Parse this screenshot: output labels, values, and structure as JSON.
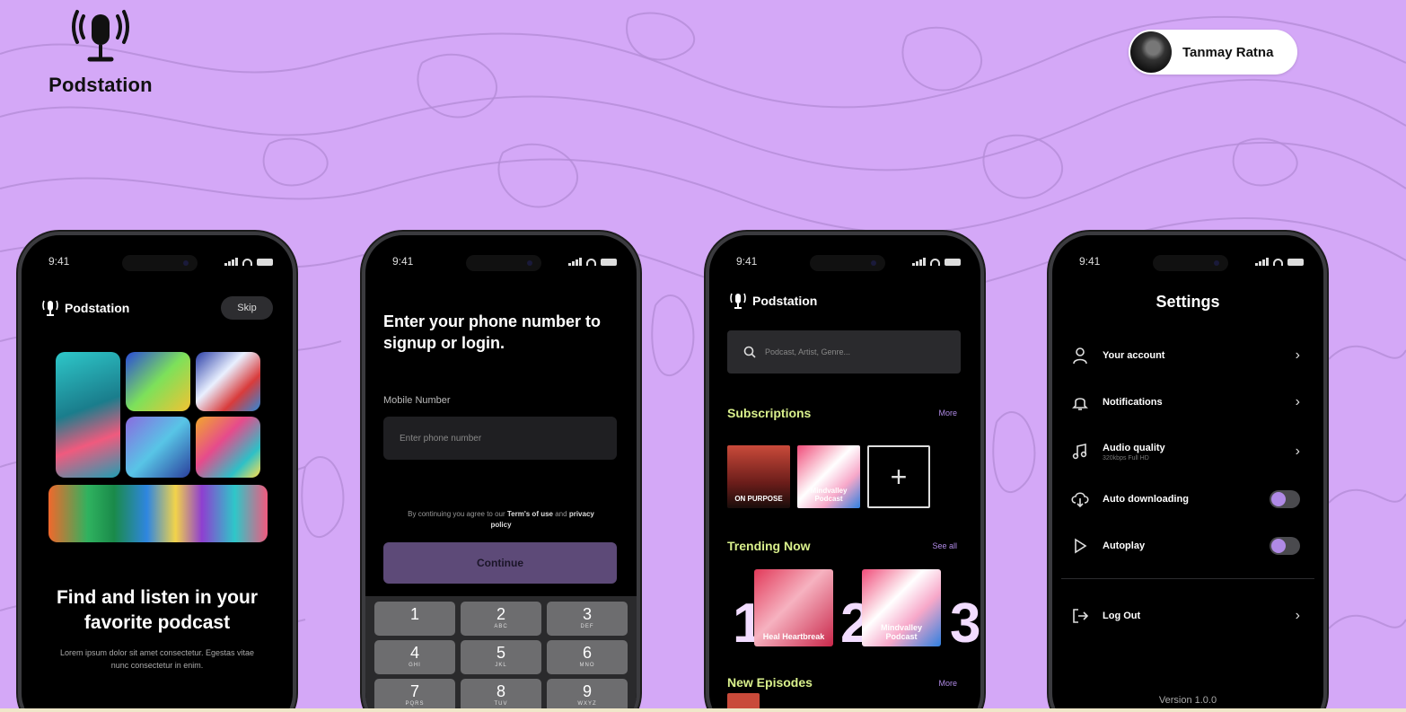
{
  "brand": {
    "name": "Podstation"
  },
  "user": {
    "name": "Tanmay Ratna"
  },
  "status_bar": {
    "time": "9:41"
  },
  "onboarding": {
    "app_name": "Podstation",
    "skip_label": "Skip",
    "title": "Find and listen in your favorite podcast",
    "subtitle": "Lorem ipsum dolor sit amet consectetur. Egestas vitae nunc consectetur in enim."
  },
  "login": {
    "title": "Enter  your phone number to signup or login.",
    "field_label": "Mobile Number",
    "phone_placeholder": "Enter phone number",
    "terms_prefix": "By continuing you agree to our",
    "terms_link": "Term's of use",
    "terms_and": "and",
    "privacy_link": "privacy policy",
    "continue_label": "Continue",
    "keypad": [
      {
        "num": "1",
        "letters": ""
      },
      {
        "num": "2",
        "letters": "ABC"
      },
      {
        "num": "3",
        "letters": "DEF"
      },
      {
        "num": "4",
        "letters": "GHI"
      },
      {
        "num": "5",
        "letters": "JKL"
      },
      {
        "num": "6",
        "letters": "MNO"
      },
      {
        "num": "7",
        "letters": "PQRS"
      },
      {
        "num": "8",
        "letters": "TUV"
      },
      {
        "num": "9",
        "letters": "WXYZ"
      }
    ]
  },
  "home": {
    "app_name": "Podstation",
    "search_placeholder": "Podcast, Artist, Genre...",
    "subscriptions": {
      "title": "Subscriptions",
      "link": "More",
      "items": [
        "ON PURPOSE",
        "Mindvalley Podcast"
      ],
      "add_label": "+"
    },
    "trending": {
      "title": "Trending Now",
      "link": "See all",
      "items": [
        {
          "rank": "1",
          "label": "Heal Heartbreak"
        },
        {
          "rank": "2",
          "label": "Mindvalley Podcast"
        },
        {
          "rank": "3",
          "label": ""
        }
      ]
    },
    "new_episodes": {
      "title": "New Episodes",
      "link": "More"
    }
  },
  "settings": {
    "title": "Settings",
    "items": [
      {
        "label": "Your account",
        "icon": "user-icon"
      },
      {
        "label": "Notifications",
        "icon": "bell-icon"
      },
      {
        "label": "Audio quality",
        "sub": "320kbps Full HD",
        "icon": "music-note-icon"
      },
      {
        "label": "Auto downloading",
        "icon": "cloud-download-icon",
        "toggle": true
      },
      {
        "label": "Autoplay",
        "icon": "play-icon",
        "toggle": true
      },
      {
        "label": "Log Out",
        "icon": "logout-icon"
      }
    ],
    "version": "Version 1.0.0"
  },
  "colors": {
    "background": "#d4a8f7",
    "accent_purple": "#b08ae6",
    "accent_lime": "#d9f08c",
    "phone_black": "#000000"
  }
}
